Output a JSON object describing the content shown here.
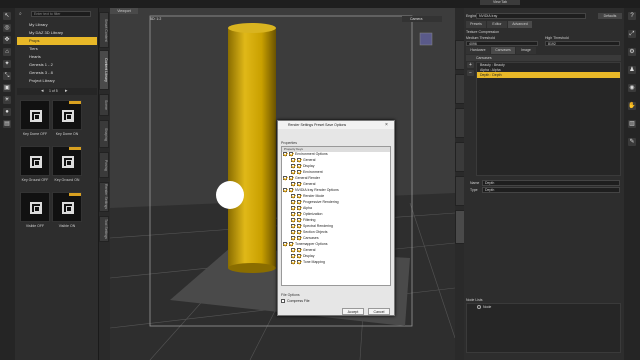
{
  "left_panel": {
    "search_placeholder": "Enter text to filter",
    "library_items": [
      {
        "label": "My Library",
        "selected": false
      },
      {
        "label": "My DAZ 3D Library",
        "selected": false
      },
      {
        "label": "Props",
        "selected": true
      },
      {
        "label": "Tiers",
        "selected": false
      },
      {
        "label": "Hearts",
        "selected": false
      },
      {
        "label": "Genesis 1 - 2",
        "selected": false
      },
      {
        "label": "Genesis 3 - 8",
        "selected": false
      },
      {
        "label": "Project Library",
        "selected": false
      }
    ],
    "page_indicator": "1 of 5",
    "thumbnails": [
      {
        "label": "Key Dome OFF"
      },
      {
        "label": "Key Dome ON"
      },
      {
        "label": "Key Ground OFF"
      },
      {
        "label": "Key Ground ON"
      },
      {
        "label": "Visible OFF"
      },
      {
        "label": "Visible ON"
      }
    ]
  },
  "left_vtabs": [
    "Smart Content",
    "Content Library",
    "Scene",
    "Shaping",
    "Posing",
    "Render Settings",
    "Tool Settings"
  ],
  "viewport": {
    "tab_label": "Viewport",
    "header_left": "5D: 1:2",
    "camera_label": "Camera"
  },
  "dialog": {
    "title": "Render Settings Preset Save Options",
    "properties_label": "Properties",
    "header_label": "Property Keys",
    "tree": [
      {
        "label": "Environment Options",
        "level": 1
      },
      {
        "label": "General",
        "level": 2
      },
      {
        "label": "Display",
        "level": 2
      },
      {
        "label": "Environment",
        "level": 2
      },
      {
        "label": "General Render",
        "level": 1
      },
      {
        "label": "General",
        "level": 2
      },
      {
        "label": "NVIDIA Iray Render Options",
        "level": 1
      },
      {
        "label": "Render Mode",
        "level": 2
      },
      {
        "label": "Progressive Rendering",
        "level": 2
      },
      {
        "label": "Alpha",
        "level": 2
      },
      {
        "label": "Optimization",
        "level": 2
      },
      {
        "label": "Filtering",
        "level": 2
      },
      {
        "label": "Spectral Rendering",
        "level": 2
      },
      {
        "label": "Section Objects",
        "level": 2
      },
      {
        "label": "Canvases",
        "level": 2
      },
      {
        "label": "Tonemapper Options",
        "level": 1
      },
      {
        "label": "General",
        "level": 2
      },
      {
        "label": "Display",
        "level": 2
      },
      {
        "label": "Tone Mapping",
        "level": 2
      }
    ],
    "file_options_label": "File Options",
    "compress_label": "Compress File",
    "accept_label": "Accept",
    "cancel_label": "Cancel"
  },
  "right_panel": {
    "engine_label": "Engine",
    "engine_value": "NVIDIA Iray",
    "defaults_label": "Defaults",
    "tabs": [
      "Presets",
      "Editor",
      "Advanced"
    ],
    "texture_compression": "Texture Compression",
    "medium_threshold_label": "Medium Threshold",
    "medium_threshold_value": "4096",
    "high_threshold_label": "High Threshold",
    "high_threshold_value": "8192",
    "sub_tabs": [
      "Hardware",
      "Canvases",
      "Image"
    ],
    "canvases_label": "Canvases",
    "canvas_items": [
      {
        "label": "Beauty : Beauty",
        "selected": false
      },
      {
        "label": "Alpha : Alpha",
        "selected": false
      },
      {
        "label": "Depth : Depth",
        "selected": true
      }
    ],
    "name_label": "Name",
    "name_value": "Depth",
    "type_label": "Type",
    "type_value": "Depth",
    "node_lists_label": "Node Lists",
    "node_value": "Node"
  },
  "top_right_tab": "View Tab"
}
